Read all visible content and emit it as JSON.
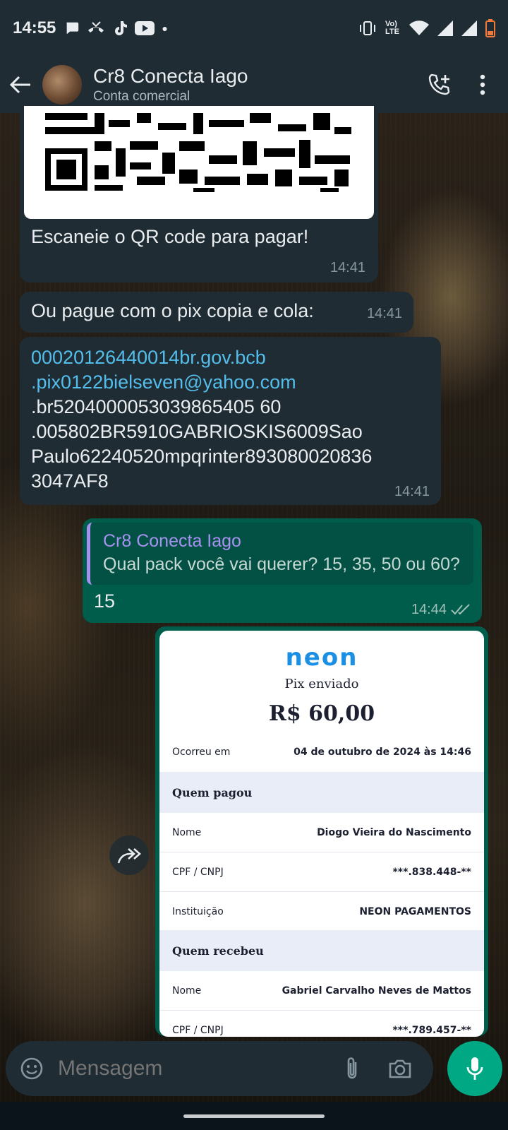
{
  "status_bar": {
    "time": "14:55",
    "network_label": "Vo) LTE"
  },
  "header": {
    "contact_name": "Cr8 Conecta Iago",
    "contact_subtitle": "Conta comercial"
  },
  "messages": {
    "qr_message": {
      "text": "Escaneie o QR code para pagar!",
      "time": "14:41"
    },
    "pix_intro": {
      "text": "Ou pague com o pix copia e cola:",
      "time": "14:41"
    },
    "pix_code": {
      "line1": "00020126440014br.gov.bcb",
      "line2": ".pix0122bielseven@yahoo.com",
      "line3": ".br5204000053039865405 60",
      "line4": ".005802BR5910GABRIOSKIS6009Sao",
      "line5": "Paulo62240520mpqrinter893080020836",
      "line6": "3047AF8",
      "time": "14:41"
    },
    "reply": {
      "quoted_name": "Cr8 Conecta Iago",
      "quoted_text": "Qual pack você vai querer?  15, 35, 50 ou 60?",
      "text": "15",
      "time": "14:44"
    }
  },
  "receipt": {
    "brand": "neon",
    "title": "Pix enviado",
    "amount": "R$ 60,00",
    "occurred_label": "Ocorreu em",
    "occurred_value": "04 de outubro de 2024 às 14:46",
    "payer_section": "Quem pagou",
    "payer_name_label": "Nome",
    "payer_name": "Diogo Vieira do Nascimento",
    "payer_doc_label": "CPF / CNPJ",
    "payer_doc": "***.838.448-**",
    "payer_inst_label": "Instituição",
    "payer_inst": "NEON PAGAMENTOS",
    "receiver_section": "Quem recebeu",
    "receiver_name_label": "Nome",
    "receiver_name": "Gabriel Carvalho Neves de Mattos",
    "receiver_doc_label": "CPF / CNPJ",
    "receiver_doc": "***.789.457-**"
  },
  "input": {
    "placeholder": "Mensagem"
  },
  "colors": {
    "header_bg": "#202c33",
    "incoming_bubble": "#202c33",
    "outgoing_bubble": "#005c4b",
    "link": "#53bdeb",
    "accent": "#00a884",
    "quote_name": "#a791f1"
  },
  "icons": [
    "back-arrow-icon",
    "add-call-icon",
    "more-vert-icon",
    "forward-icon",
    "emoji-icon",
    "attach-icon",
    "camera-icon",
    "mic-icon",
    "double-check-icon"
  ]
}
